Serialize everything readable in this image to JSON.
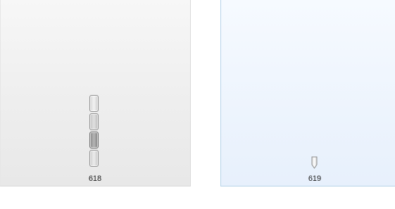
{
  "tiles": [
    {
      "caption": "618"
    },
    {
      "caption": "619"
    }
  ]
}
